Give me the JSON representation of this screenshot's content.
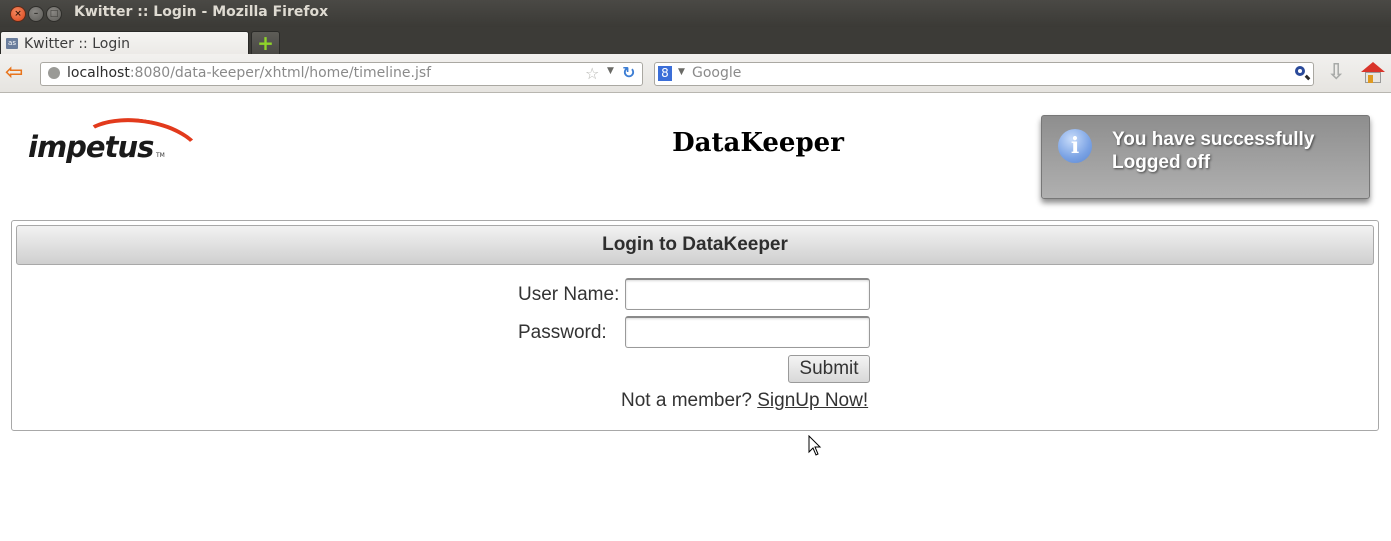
{
  "window": {
    "title": "Kwitter :: Login - Mozilla Firefox",
    "buttons": {
      "close": "×",
      "minimize": "–",
      "maximize": "□"
    }
  },
  "tabs": [
    {
      "label": "Kwitter :: Login",
      "favicon": "as",
      "active": true
    }
  ],
  "new_tab_label": "+",
  "navbar": {
    "url_host": "localhost",
    "url_rest": ":8080/data-keeper/xhtml/home/timeline.jsf",
    "search_engine": "Google",
    "search_placeholder": "Google",
    "icons": [
      "back-arrow-icon",
      "globe-icon",
      "bookmark-star-icon",
      "dropdown-icon",
      "reload-icon",
      "google-icon",
      "search-icon",
      "download-icon",
      "home-icon"
    ]
  },
  "page": {
    "logo_text": "impetus",
    "logo_tm": "TM",
    "title": "DataKeeper",
    "notification": {
      "icon": "info-icon",
      "message": "You have successfully Logged off"
    },
    "login_panel": {
      "header": "Login to DataKeeper",
      "username_label": "User Name:",
      "username_value": "",
      "password_label": "Password:",
      "password_value": "",
      "submit_label": "Submit",
      "signup_prompt": "Not a member?",
      "signup_link": "SignUp Now!"
    }
  }
}
